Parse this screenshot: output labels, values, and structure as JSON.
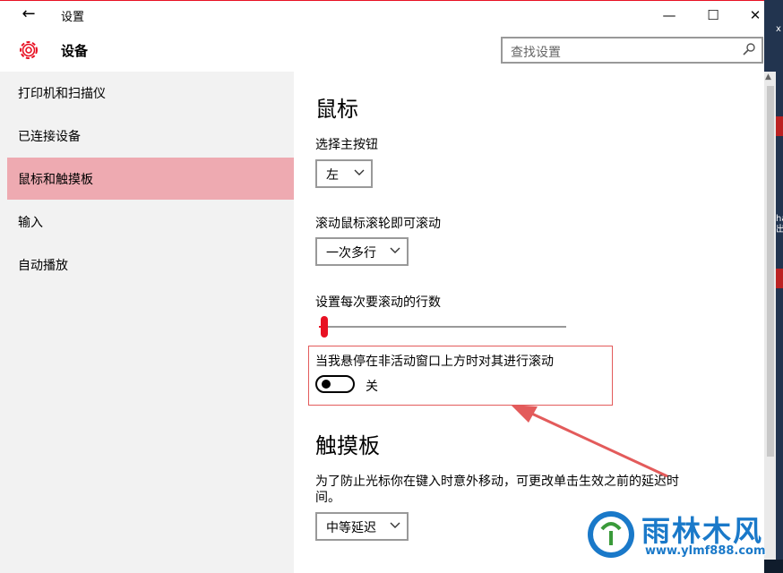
{
  "window": {
    "title": "设置",
    "minimize": "—",
    "maximize": "☐",
    "close": "✕"
  },
  "header": {
    "section_title": "设备",
    "search": {
      "placeholder": "查找设置"
    }
  },
  "sidebar": {
    "items": [
      {
        "label": "打印机和扫描仪",
        "selected": false
      },
      {
        "label": "已连接设备",
        "selected": false
      },
      {
        "label": "鼠标和触摸板",
        "selected": true
      },
      {
        "label": "输入",
        "selected": false
      },
      {
        "label": "自动播放",
        "selected": false
      }
    ]
  },
  "mouse": {
    "heading": "鼠标",
    "primary_button": {
      "label": "选择主按钮",
      "value": "左"
    },
    "wheel_scroll": {
      "label": "滚动鼠标滚轮即可滚动",
      "value": "一次多行"
    },
    "lines_per_scroll": {
      "label": "设置每次要滚动的行数",
      "level_fraction": 0.02
    },
    "inactive_scroll": {
      "label": "当我悬停在非活动窗口上方时对其进行滚动",
      "state": "关",
      "on": false
    }
  },
  "touchpad": {
    "heading": "触摸板",
    "delay_desc_line1": "为了防止光标你在键入时意外移动，可更改单击生效之前的延迟时",
    "delay_desc_line2": "间。",
    "delay_value": "中等延迟"
  },
  "watermark": {
    "title": "雨林木风",
    "url": "www.ylmf888.com"
  },
  "desktop": {
    "glyphs": [
      "x",
      "ha",
      "出"
    ]
  },
  "colors": {
    "accent": "#e81123",
    "selected_bg": "#eeaab1",
    "annotation": "#e35b5b"
  }
}
